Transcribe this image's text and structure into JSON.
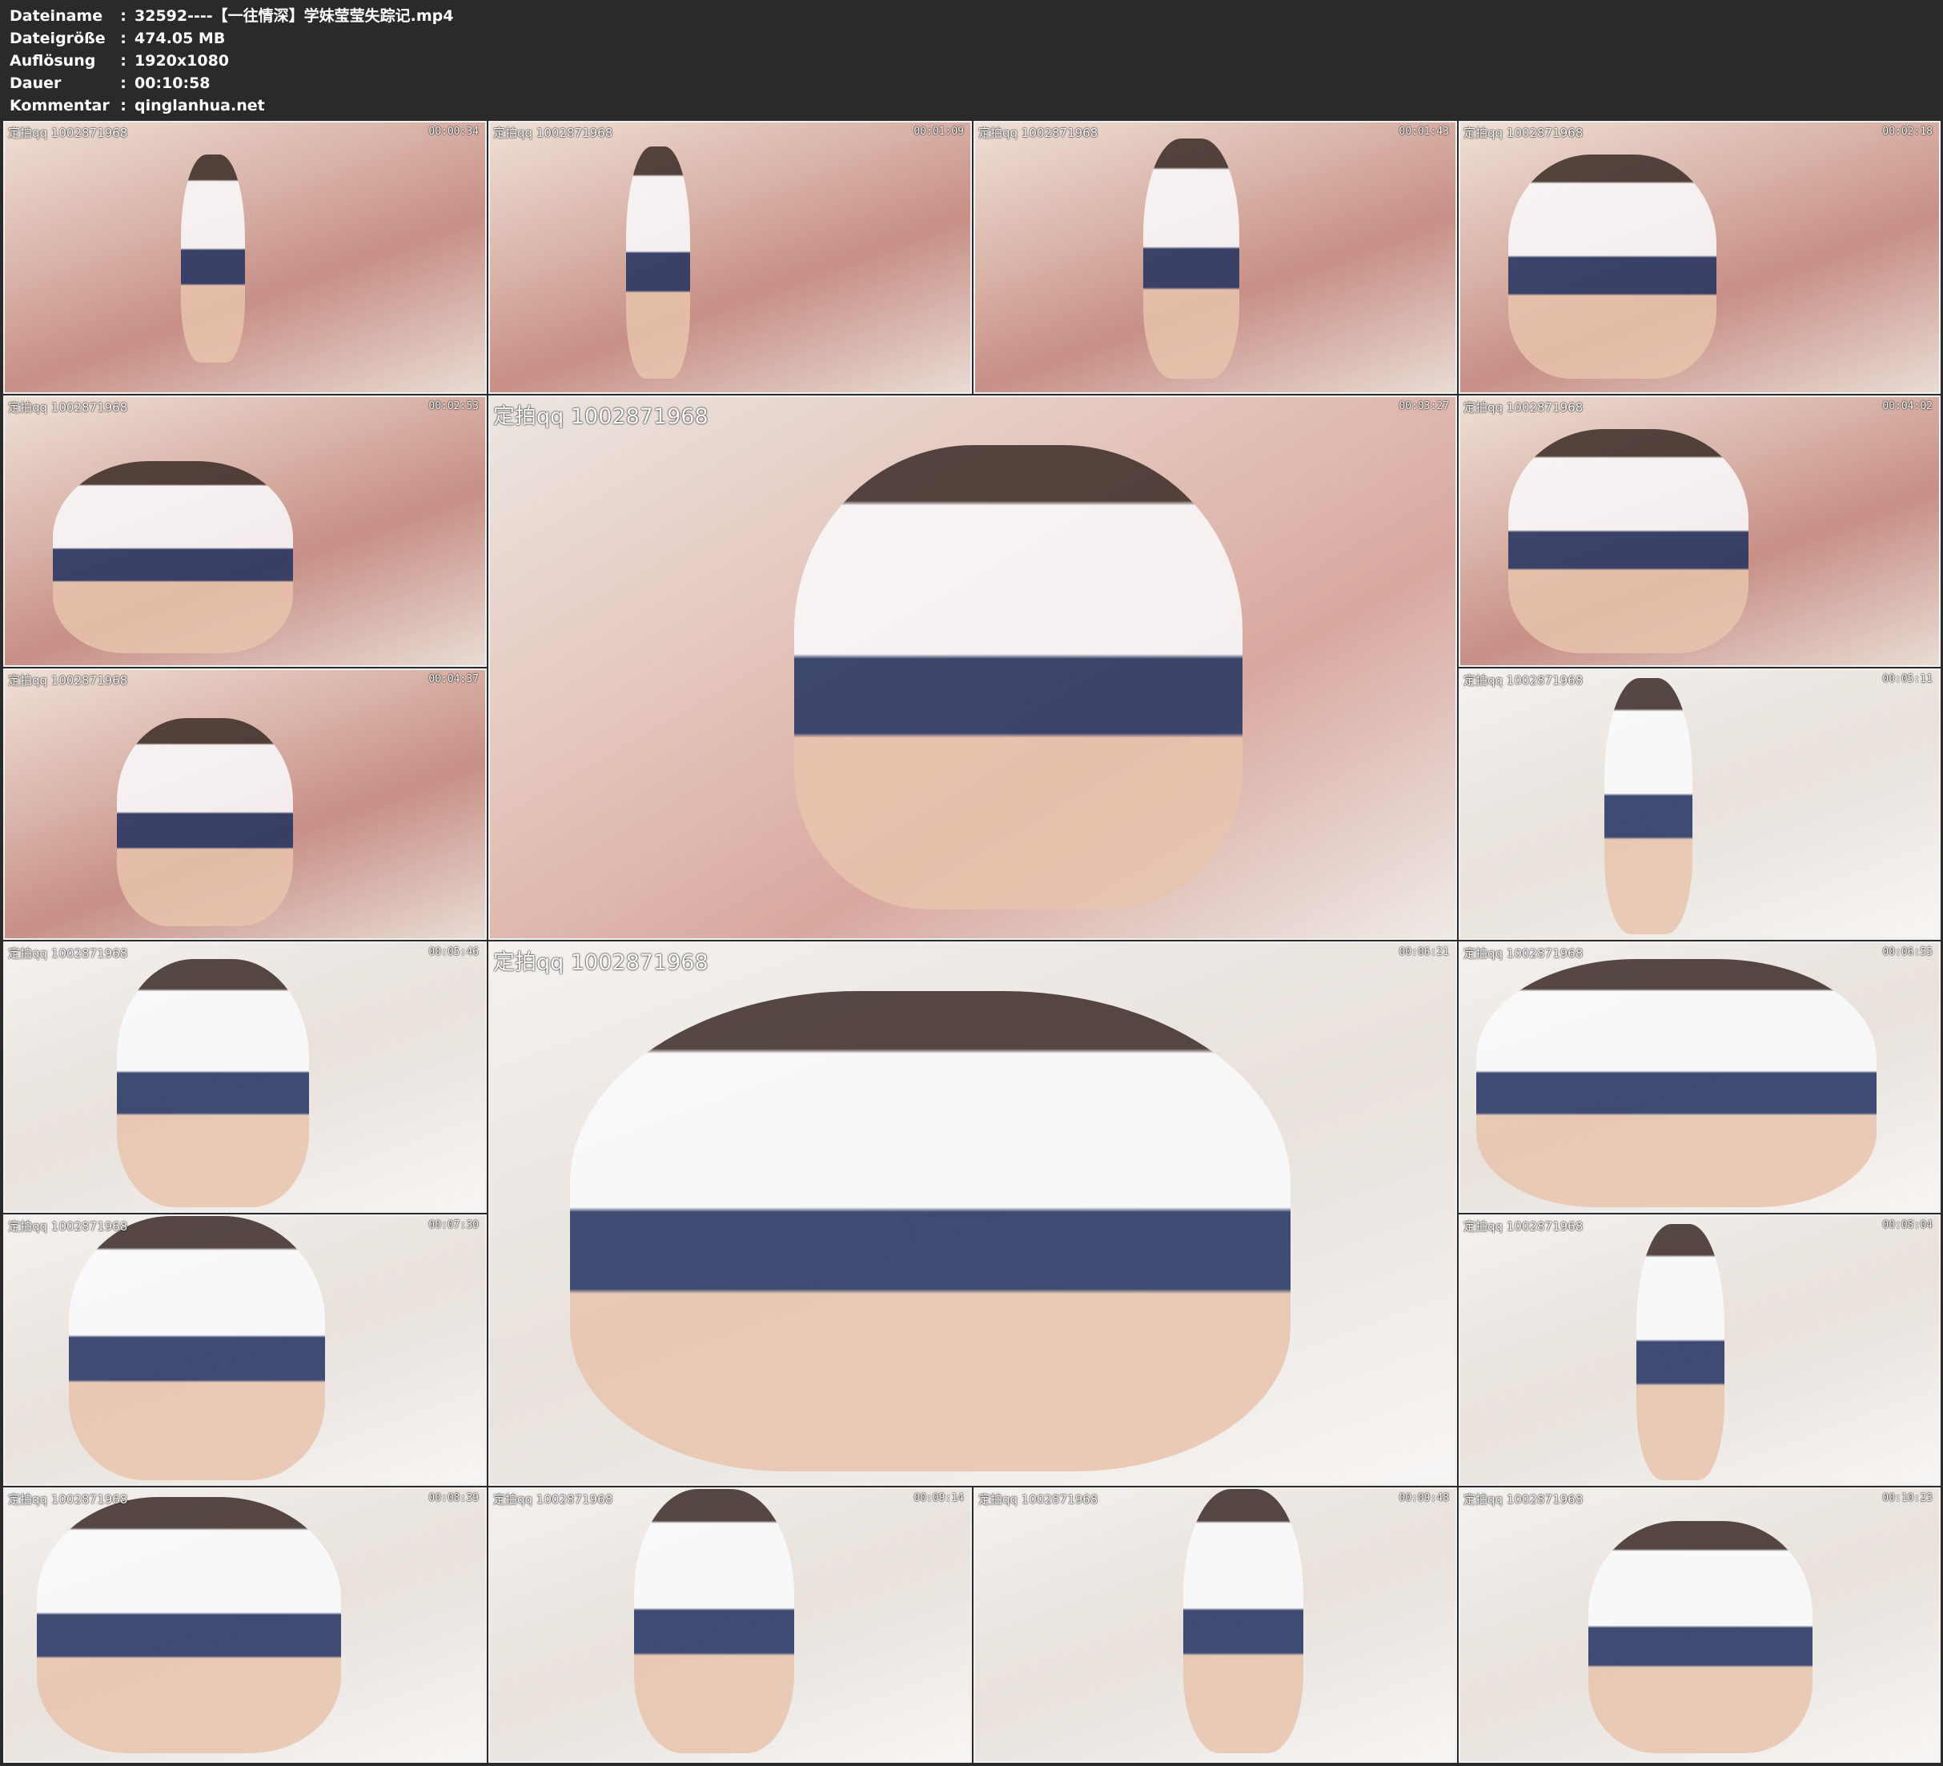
{
  "header": {
    "rows": [
      {
        "label": "Dateiname",
        "colon": ":",
        "value": "32592----【一往情深】学妹莹莹失踪记.mp4"
      },
      {
        "label": "Dateigröße",
        "colon": ":",
        "value": "474.05 MB"
      },
      {
        "label": "Auflösung",
        "colon": ":",
        "value": "1920x1080"
      },
      {
        "label": "Dauer",
        "colon": ":",
        "value": "00:10:58"
      },
      {
        "label": "Kommentar",
        "colon": ":",
        "value": "qinglanhua.net"
      }
    ]
  },
  "thumbnails": [
    {
      "watermark": "定拍qq 1002871968",
      "timestamp": "00:00:34"
    },
    {
      "watermark": "定拍qq 1002871968",
      "timestamp": "00:01:09"
    },
    {
      "watermark": "定拍qq 1002871968",
      "timestamp": "00:01:43"
    },
    {
      "watermark": "定拍qq 1002871968",
      "timestamp": "00:02:18"
    },
    {
      "watermark": "定拍qq 1002871968",
      "timestamp": "00:02:53"
    },
    {
      "watermark": "定拍qq 1002871968",
      "timestamp": "00:03:27"
    },
    {
      "watermark": "定拍qq 1002871968",
      "timestamp": "00:04:02"
    },
    {
      "watermark": "定拍qq 1002871968",
      "timestamp": "00:04:37"
    },
    {
      "watermark": "定拍qq 1002871968",
      "timestamp": "00:05:11"
    },
    {
      "watermark": "定拍qq 1002871968",
      "timestamp": "00:05:46"
    },
    {
      "watermark": "定拍qq 1002871968",
      "timestamp": "00:06:21"
    },
    {
      "watermark": "定拍qq 1002871968",
      "timestamp": "00:06:55"
    },
    {
      "watermark": "定拍qq 1002871968",
      "timestamp": "00:07:30"
    },
    {
      "watermark": "定拍qq 1002871968",
      "timestamp": "00:08:04"
    },
    {
      "watermark": "定拍qq 1002871968",
      "timestamp": "00:08:39"
    },
    {
      "watermark": "定拍qq 1002871968",
      "timestamp": "00:09:14"
    },
    {
      "watermark": "定拍qq 1002871968",
      "timestamp": "00:09:48"
    },
    {
      "watermark": "定拍qq 1002871968",
      "timestamp": "00:10:23"
    }
  ]
}
